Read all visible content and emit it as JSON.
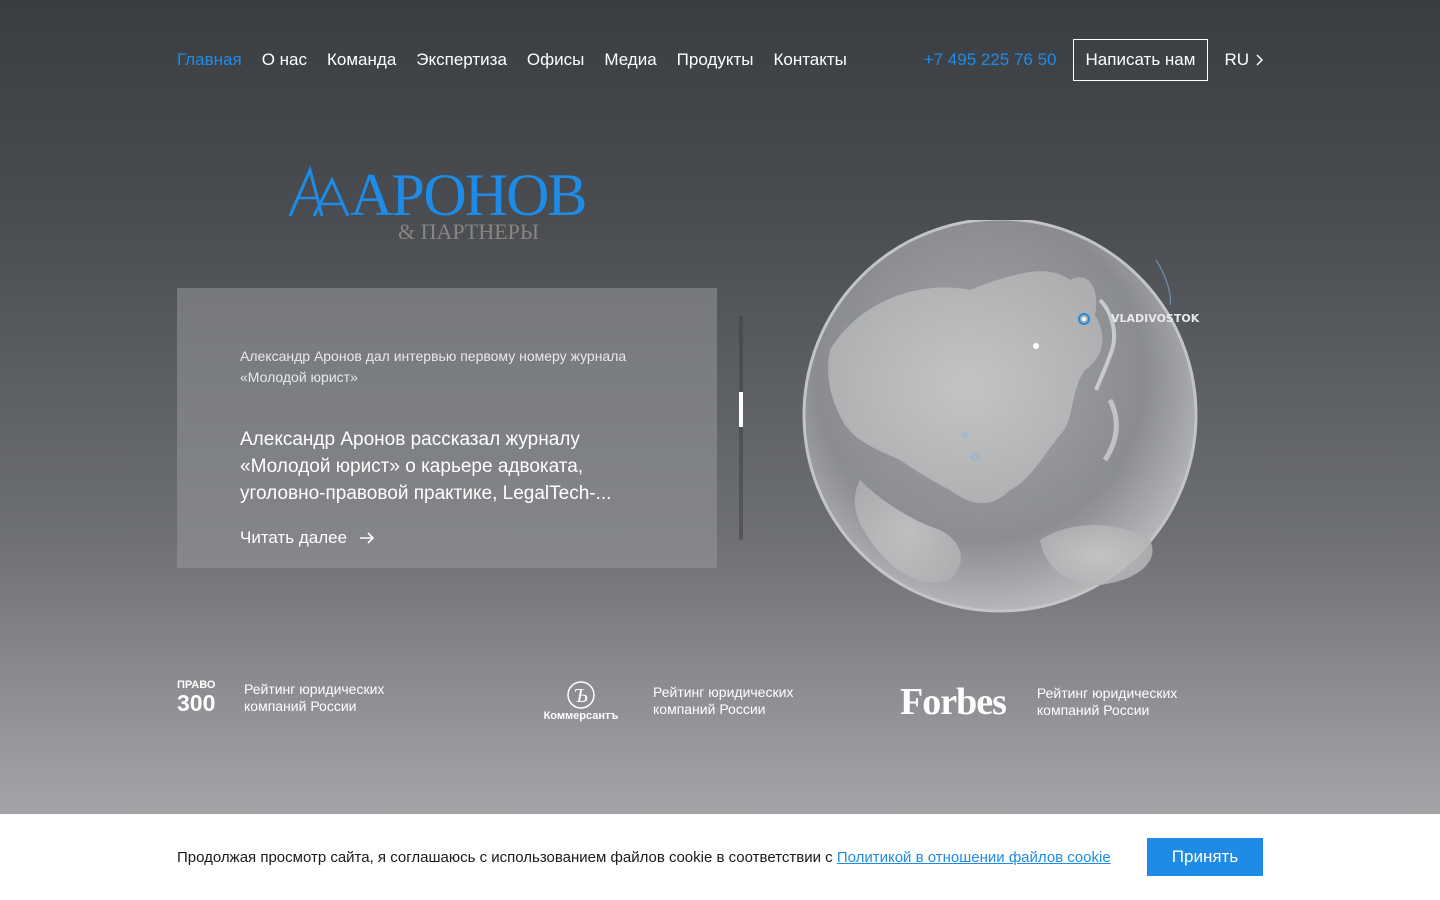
{
  "nav": {
    "links": [
      "Главная",
      "О нас",
      "Команда",
      "Экспертиза",
      "Офисы",
      "Медиа",
      "Продукты",
      "Контакты"
    ],
    "phone": "+7 495 225 76 50",
    "write_label": "Написать нам",
    "lang": "RU"
  },
  "logo": {
    "main": "АРОНОВ",
    "sub": "& ПАРТНЕРЫ"
  },
  "news": {
    "subtitle": "Александр Аронов дал интервью первому номеру журнала «Молодой юрист»",
    "title": "Александр Аронов рассказал журналу «Молодой юрист» о карьере адвоката, уголовно-правовой практике, LegalTech-...",
    "more_label": "Читать далее"
  },
  "globe": {
    "city_label": "VLADIVOSTOK"
  },
  "ratings": [
    {
      "logo_small": "ПРАВО",
      "logo_big": "300",
      "text": "Рейтинг юридических компаний России"
    },
    {
      "logo": "Коммерсантъ",
      "text": "Рейтинг юридических компаний России"
    },
    {
      "logo": "Forbes",
      "text": "Рейтинг юридических компаний России"
    }
  ],
  "cookie": {
    "text": "Продолжая просмотр сайта, я соглашаюсь с использованием файлов cookie в соответствии с ",
    "link": "Политикой в отношении файлов cookie",
    "accept_label": "Принять"
  },
  "colors": {
    "accent": "#1e8ce6",
    "logo_sub": "#8a8580"
  }
}
